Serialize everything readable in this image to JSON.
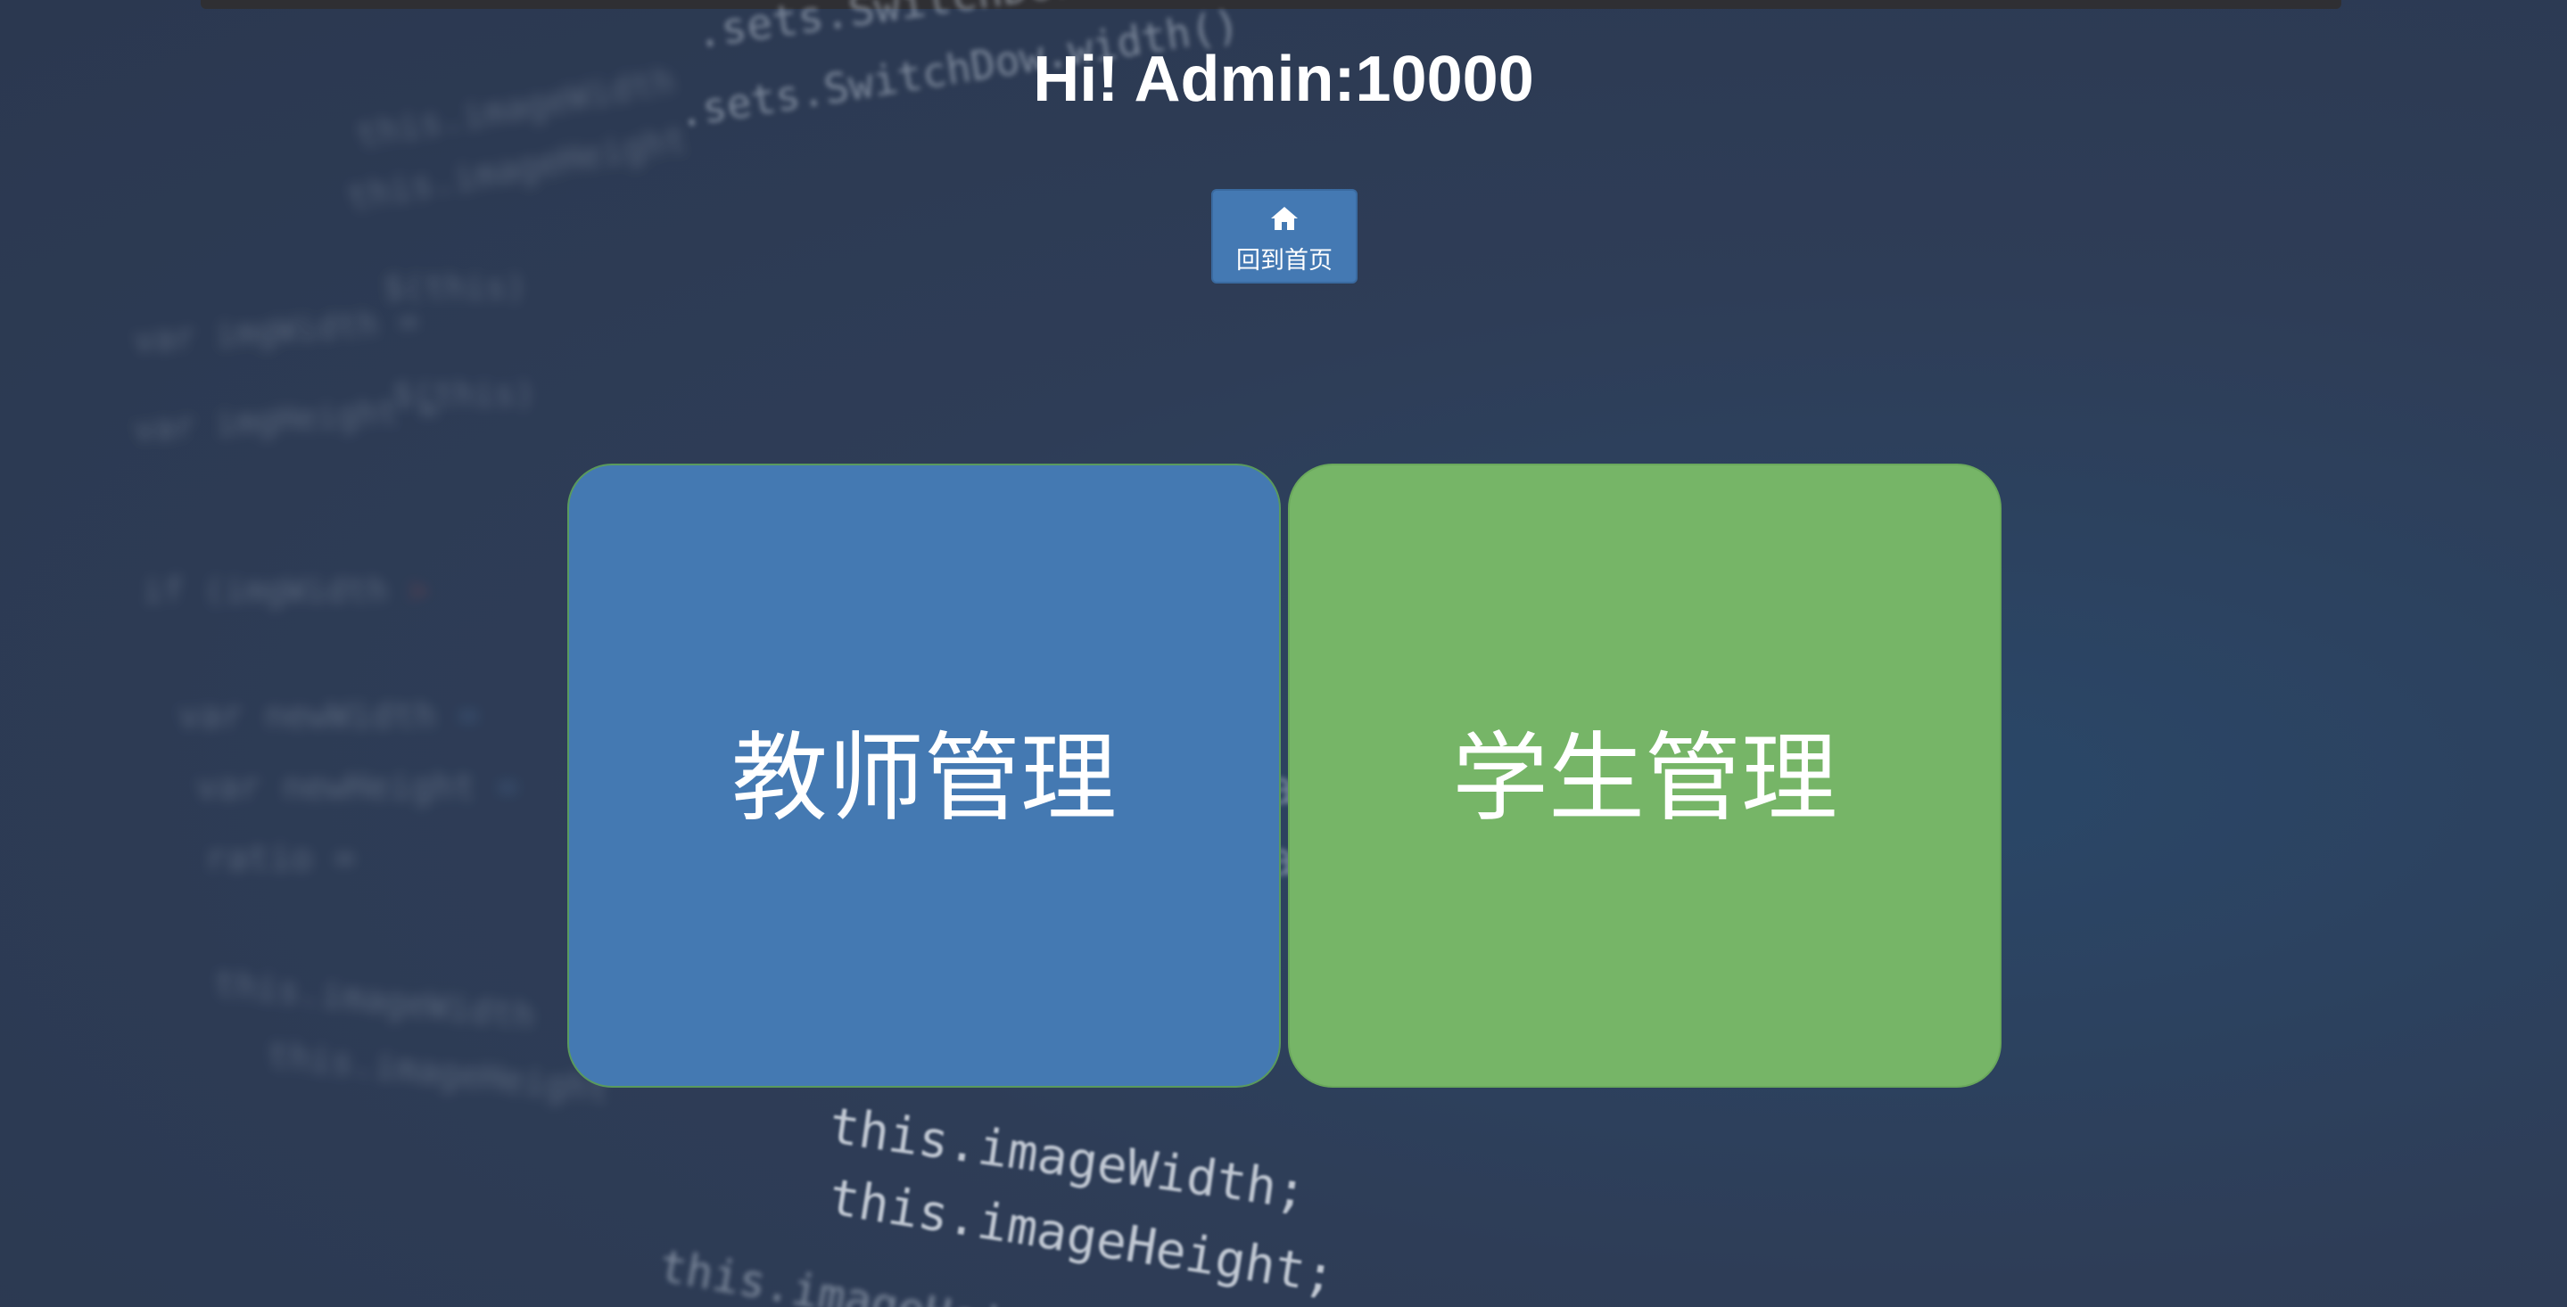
{
  "header": {
    "greeting": "Hi! Admin:10000"
  },
  "home_button": {
    "icon": "home-icon",
    "label": "回到首页",
    "color": "#4479b3"
  },
  "cards": [
    {
      "label": "教师管理",
      "color": "#4479b2"
    },
    {
      "label": "学生管理",
      "color": "#76b567"
    }
  ]
}
